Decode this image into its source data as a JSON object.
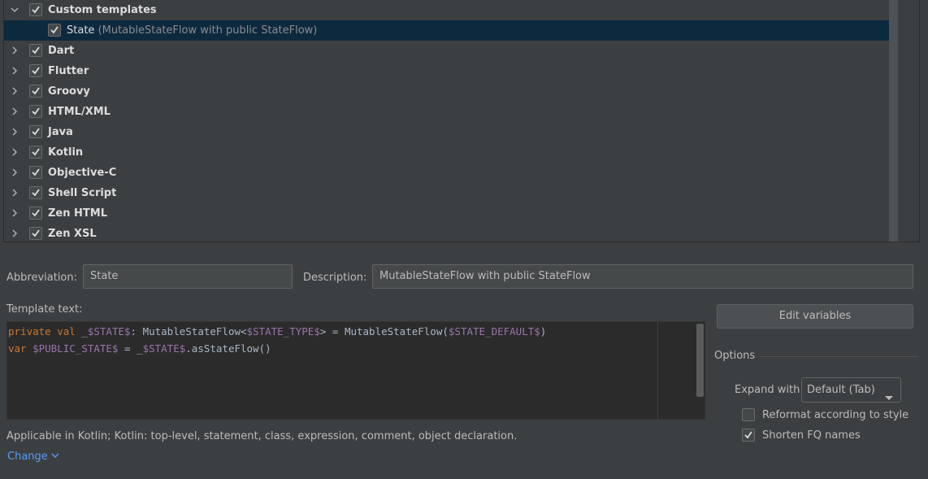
{
  "tree": {
    "groups": [
      {
        "label": "Custom templates",
        "expanded": true,
        "checked": true
      },
      {
        "label": "Dart",
        "expanded": false,
        "checked": true
      },
      {
        "label": "Flutter",
        "expanded": false,
        "checked": true
      },
      {
        "label": "Groovy",
        "expanded": false,
        "checked": true
      },
      {
        "label": "HTML/XML",
        "expanded": false,
        "checked": true
      },
      {
        "label": "Java",
        "expanded": false,
        "checked": true
      },
      {
        "label": "Kotlin",
        "expanded": false,
        "checked": true
      },
      {
        "label": "Objective-C",
        "expanded": false,
        "checked": true
      },
      {
        "label": "Shell Script",
        "expanded": false,
        "checked": true
      },
      {
        "label": "Zen HTML",
        "expanded": false,
        "checked": true
      },
      {
        "label": "Zen XSL",
        "expanded": false,
        "checked": true
      }
    ],
    "selected_template": {
      "name": "State",
      "description": "(MutableStateFlow with public StateFlow)",
      "checked": true
    }
  },
  "form": {
    "abbreviation_label": "Abbreviation:",
    "abbreviation_value": "State",
    "description_label": "Description:",
    "description_value": "MutableStateFlow with public StateFlow",
    "template_text_label": "Template text:"
  },
  "editor": {
    "line1": {
      "kw1": "private val ",
      "t1": "_",
      "v1": "$STATE$",
      "t2": ": MutableStateFlow<",
      "v2": "$STATE_TYPE$",
      "t3": "> = MutableStateFlow(",
      "v3": "$STATE_DEFAULT$",
      "t4": ")"
    },
    "line2": {
      "kw1": "var ",
      "v1": "$PUBLIC_STATE$",
      "t1": " = _",
      "v2": "$STATE$",
      "t2": ".asStateFlow()"
    }
  },
  "edit_variables_label": "Edit variables",
  "options": {
    "title": "Options",
    "expand_with_label": "Expand with",
    "expand_with_value": "Default (Tab)",
    "reformat_label": "Reformat according to style",
    "reformat_checked": false,
    "shorten_label": "Shorten FQ names",
    "shorten_checked": true
  },
  "applicable_text": "Applicable in Kotlin; Kotlin: top-level, statement, class, expression, comment, object declaration.",
  "change_link": "Change",
  "colors": {
    "background": "#3c3f41",
    "selection": "#0d293e",
    "link": "#589df6",
    "keyword": "#cc7832",
    "template_var": "#9876aa"
  }
}
